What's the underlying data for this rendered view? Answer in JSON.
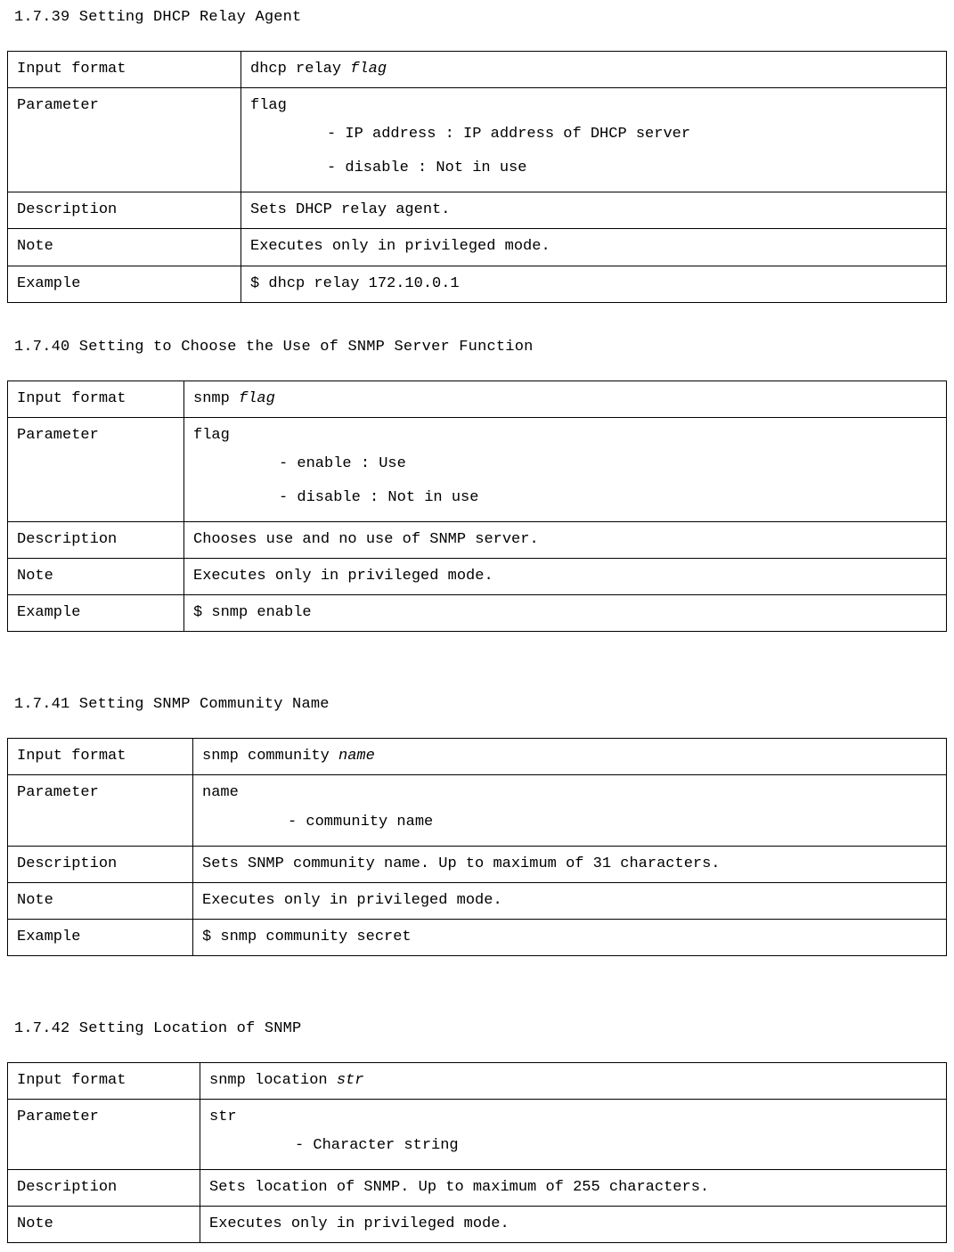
{
  "labels": {
    "input_format": "Input format",
    "parameter": "Parameter",
    "description": "Description",
    "note": "Note",
    "example": "Example"
  },
  "sections": [
    {
      "heading": "1.7.39 Setting DHCP Relay Agent",
      "label_col": "wide",
      "gap": "none",
      "input_prefix": "dhcp relay ",
      "input_arg": "flag",
      "param_head": "flag",
      "param_lines": [
        "- IP address : IP address of DHCP server",
        "- disable : Not in use"
      ],
      "param_indent": "narrow",
      "description": "Sets DHCP relay agent.",
      "note": "Executes only in privileged mode.",
      "example": "$ dhcp relay 172.10.0.1",
      "show_example": true
    },
    {
      "heading": "1.7.40 Setting to Choose the Use of SNMP Server Function",
      "label_col": "mid",
      "gap": "small",
      "input_prefix": "snmp ",
      "input_arg": "flag",
      "param_head": "flag",
      "param_lines": [
        "- enable : Use",
        "- disable : Not in use"
      ],
      "param_indent": "wide",
      "description": "Chooses use and no use of SNMP server.",
      "note": "Executes only in privileged mode.",
      "example": "$ snmp enable",
      "show_example": true
    },
    {
      "heading": "1.7.41 Setting SNMP Community Name",
      "label_col": "mid2",
      "gap": "large",
      "input_prefix": "snmp community ",
      "input_arg": "name",
      "param_head": "name",
      "param_lines": [
        "- community name"
      ],
      "param_indent": "wide",
      "description": "Sets SNMP community name. Up to maximum of 31 characters.",
      "note": "Executes only in privileged mode.",
      "example": "$ snmp community secret",
      "show_example": true
    },
    {
      "heading": "1.7.42 Setting Location of SNMP",
      "label_col": "mid3",
      "gap": "large",
      "input_prefix": "snmp location ",
      "input_arg": "str",
      "param_head": "str",
      "param_lines": [
        "- Character string"
      ],
      "param_indent": "wide",
      "description": "Sets location of SNMP. Up to maximum of 255 characters.",
      "note": "Executes only in privileged mode.",
      "example": "",
      "show_example": false
    }
  ]
}
